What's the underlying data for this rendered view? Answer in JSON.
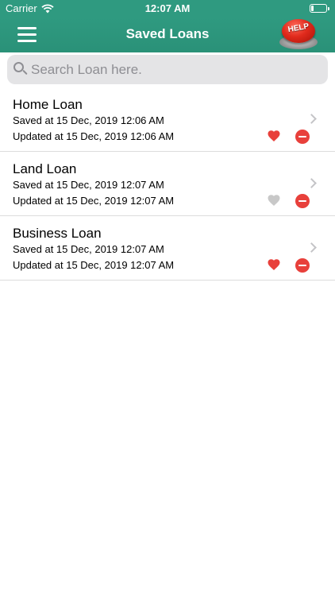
{
  "status": {
    "carrier": "Carrier",
    "time": "12:07 AM"
  },
  "nav": {
    "title": "Saved Loans",
    "help_label": "HELP"
  },
  "search": {
    "placeholder": "Search Loan here."
  },
  "colors": {
    "header": "#2f9a80",
    "favorite_on": "#e8403b",
    "favorite_off": "#c8c8c8",
    "remove": "#e8403b"
  },
  "loans": [
    {
      "name": "Home Loan",
      "saved": "Saved at 15 Dec, 2019 12:06 AM",
      "updated": "Updated at 15 Dec, 2019 12:06 AM",
      "favorite": true
    },
    {
      "name": "Land Loan",
      "saved": "Saved at 15 Dec, 2019 12:07 AM",
      "updated": "Updated at 15 Dec, 2019 12:07 AM",
      "favorite": false
    },
    {
      "name": "Business Loan",
      "saved": "Saved at 15 Dec, 2019 12:07 AM",
      "updated": "Updated at 15 Dec, 2019 12:07 AM",
      "favorite": true
    }
  ]
}
